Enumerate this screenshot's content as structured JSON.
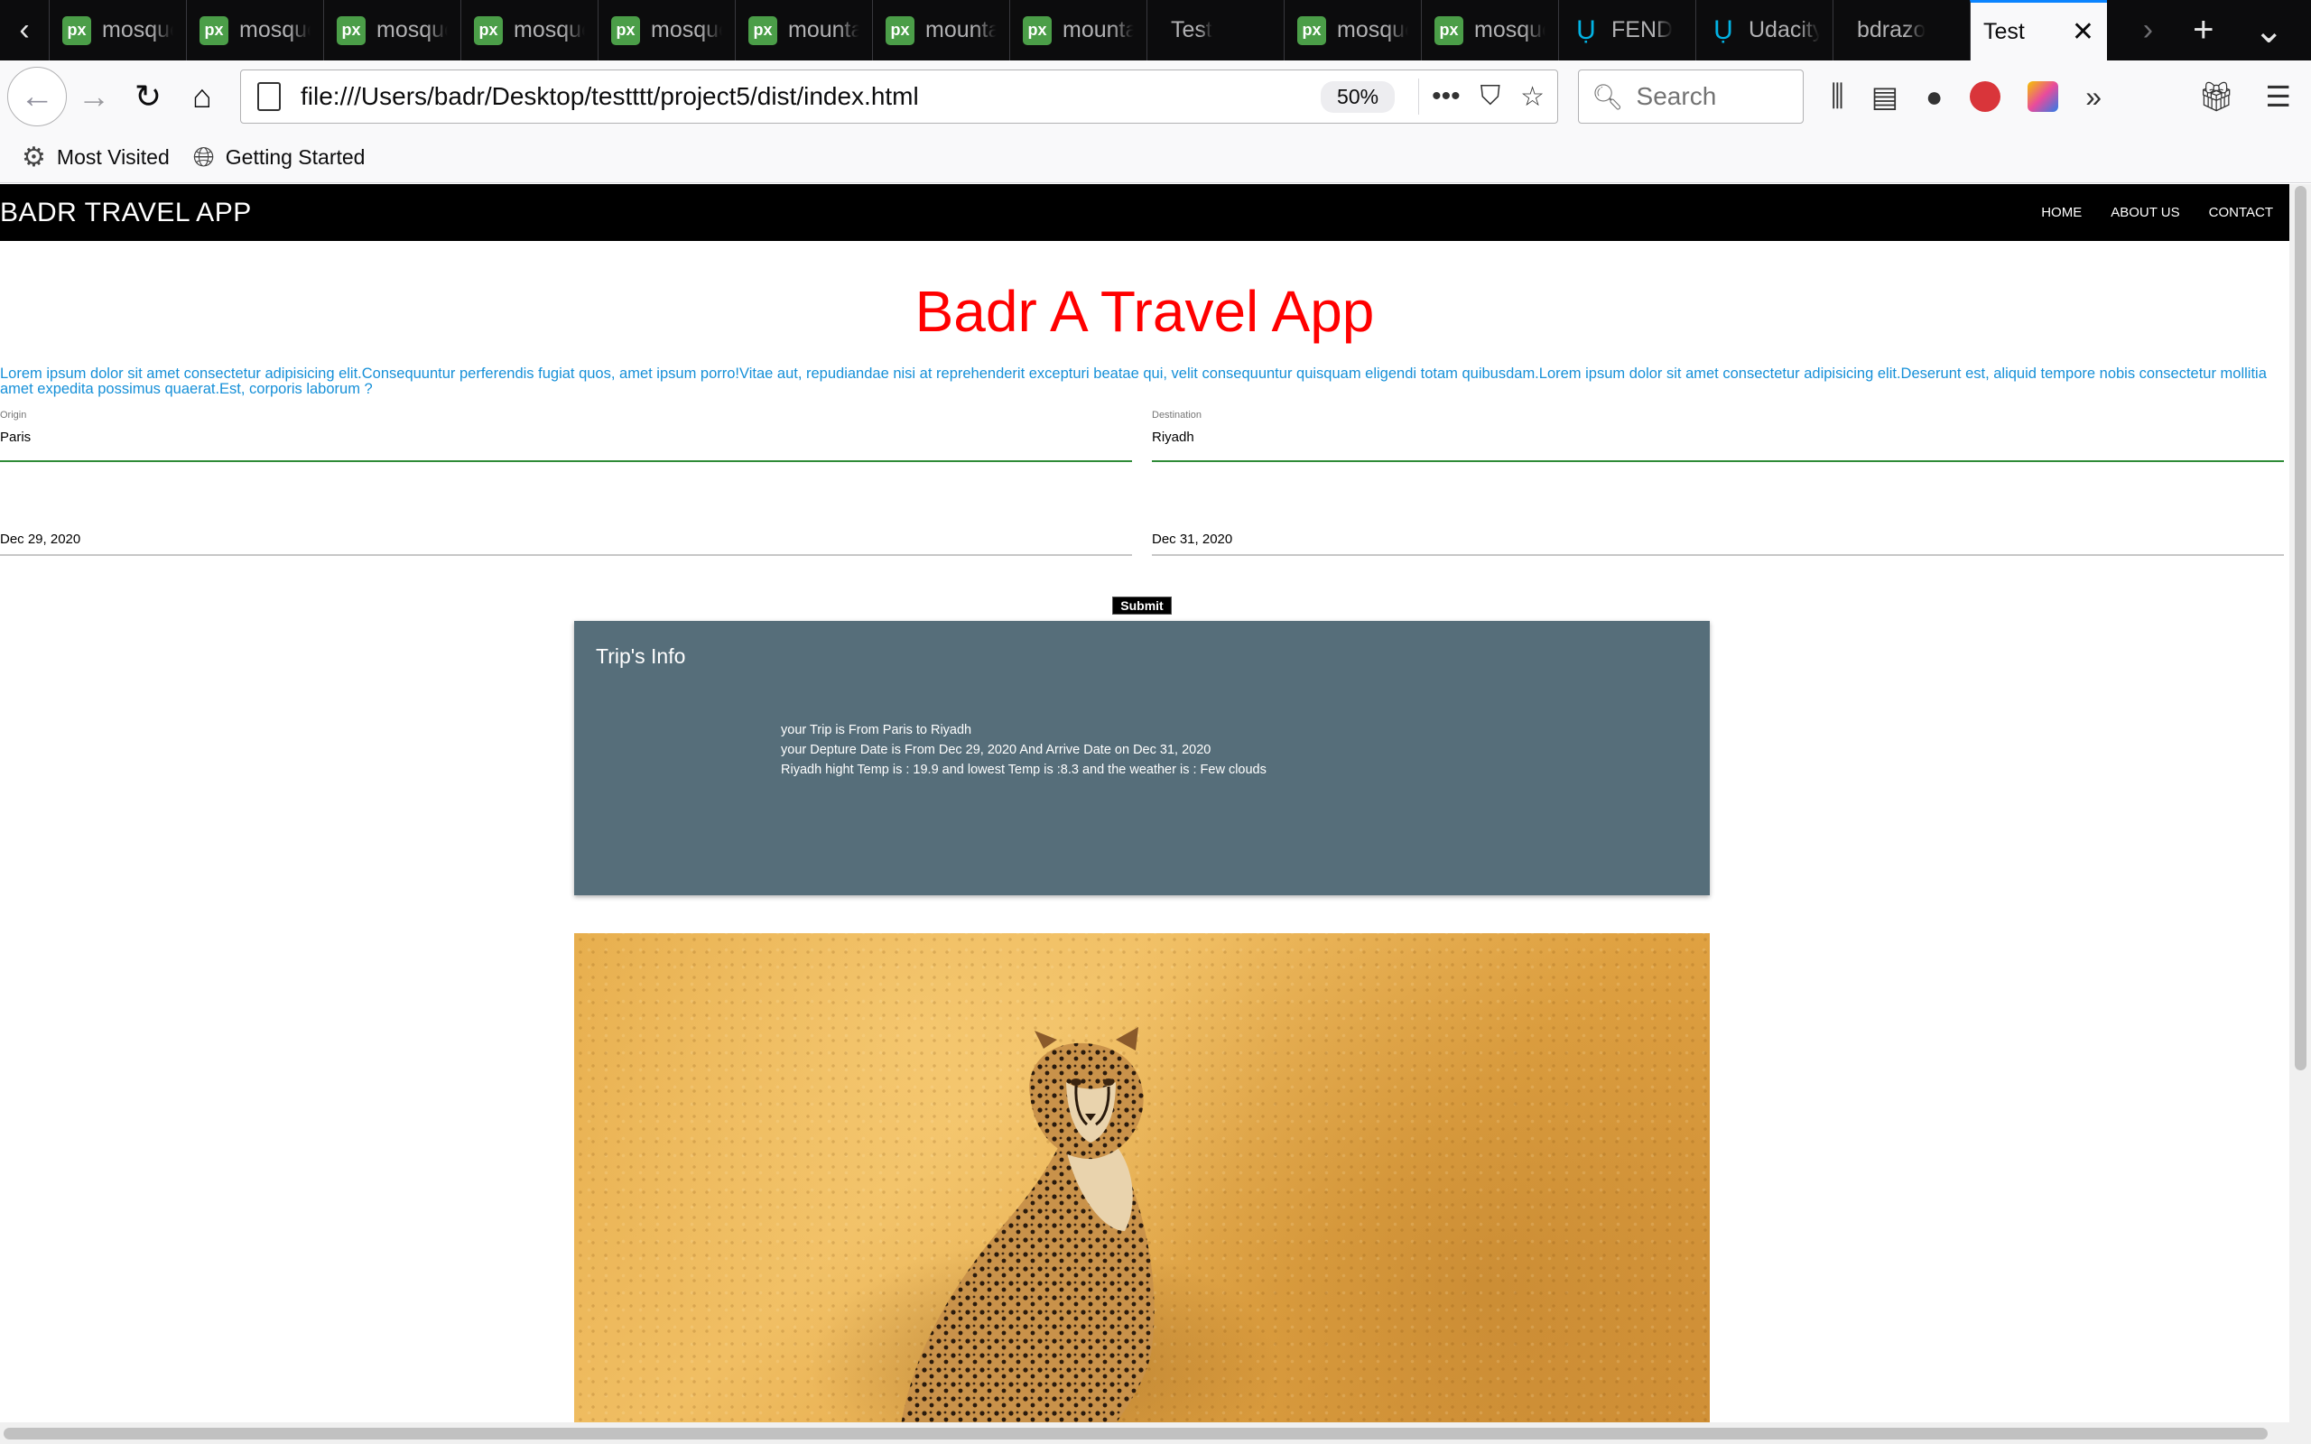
{
  "browser": {
    "tabs": [
      {
        "label": "mosque",
        "icon": "px"
      },
      {
        "label": "mosque",
        "icon": "px"
      },
      {
        "label": "mosque",
        "icon": "px"
      },
      {
        "label": "mosque",
        "icon": "px"
      },
      {
        "label": "mosque",
        "icon": "px"
      },
      {
        "label": "mountain",
        "icon": "px"
      },
      {
        "label": "mountain",
        "icon": "px"
      },
      {
        "label": "mountain",
        "icon": "px"
      },
      {
        "label": "Test",
        "icon": "none"
      },
      {
        "label": "mosque",
        "icon": "px"
      },
      {
        "label": "mosque",
        "icon": "px"
      },
      {
        "label": "FEND",
        "icon": "udacity"
      },
      {
        "label": "Udacity",
        "icon": "udacity"
      },
      {
        "label": "bdrazo",
        "icon": "none"
      }
    ],
    "active_tab": "Test",
    "url": "file:///Users/badr/Desktop/testttt/project5/dist/index.html",
    "zoom": "50%",
    "search_placeholder": "Search",
    "bookmarks": [
      {
        "label": "Most Visited",
        "icon": "gear-icon"
      },
      {
        "label": "Getting Started",
        "icon": "globe-icon"
      }
    ]
  },
  "site": {
    "brand": "BADR TRAVEL APP",
    "nav": [
      "HOME",
      "ABOUT US",
      "CONTACT"
    ],
    "title": "Badr A Travel App",
    "intro": "Lorem ipsum dolor sit amet consectetur adipisicing elit.Consequuntur perferendis fugiat quos, amet ipsum porro!Vitae aut, repudiandae nisi at reprehenderit excepturi beatae qui, velit consequuntur quisquam eligendi totam quibusdam.Lorem ipsum dolor sit amet consectetur adipisicing elit.Deserunt est, aliquid tempore nobis consectetur mollitia amet expedita possimus quaerat.Est, corporis laborum ?",
    "origin": {
      "label": "Origin",
      "value": "Paris"
    },
    "destination": {
      "label": "Destination",
      "value": "Riyadh"
    },
    "depart_date": "Dec 29, 2020",
    "arrive_date": "Dec 31, 2020",
    "submit_label": "Submit",
    "trip_info": {
      "title": "Trip's Info",
      "lines": [
        "your Trip is From Paris to Riyadh",
        "your Depture Date is From Dec 29, 2020 And Arrive Date on Dec 31, 2020",
        "Riyadh hight Temp is : 19.9 and lowest Temp is :8.3 and the weather is : Few clouds"
      ]
    }
  },
  "colors": {
    "title_red": "#ff0000",
    "intro_blue": "#1690d8",
    "card_bg": "#566e7a",
    "input_focus_green": "#2e8b37"
  }
}
